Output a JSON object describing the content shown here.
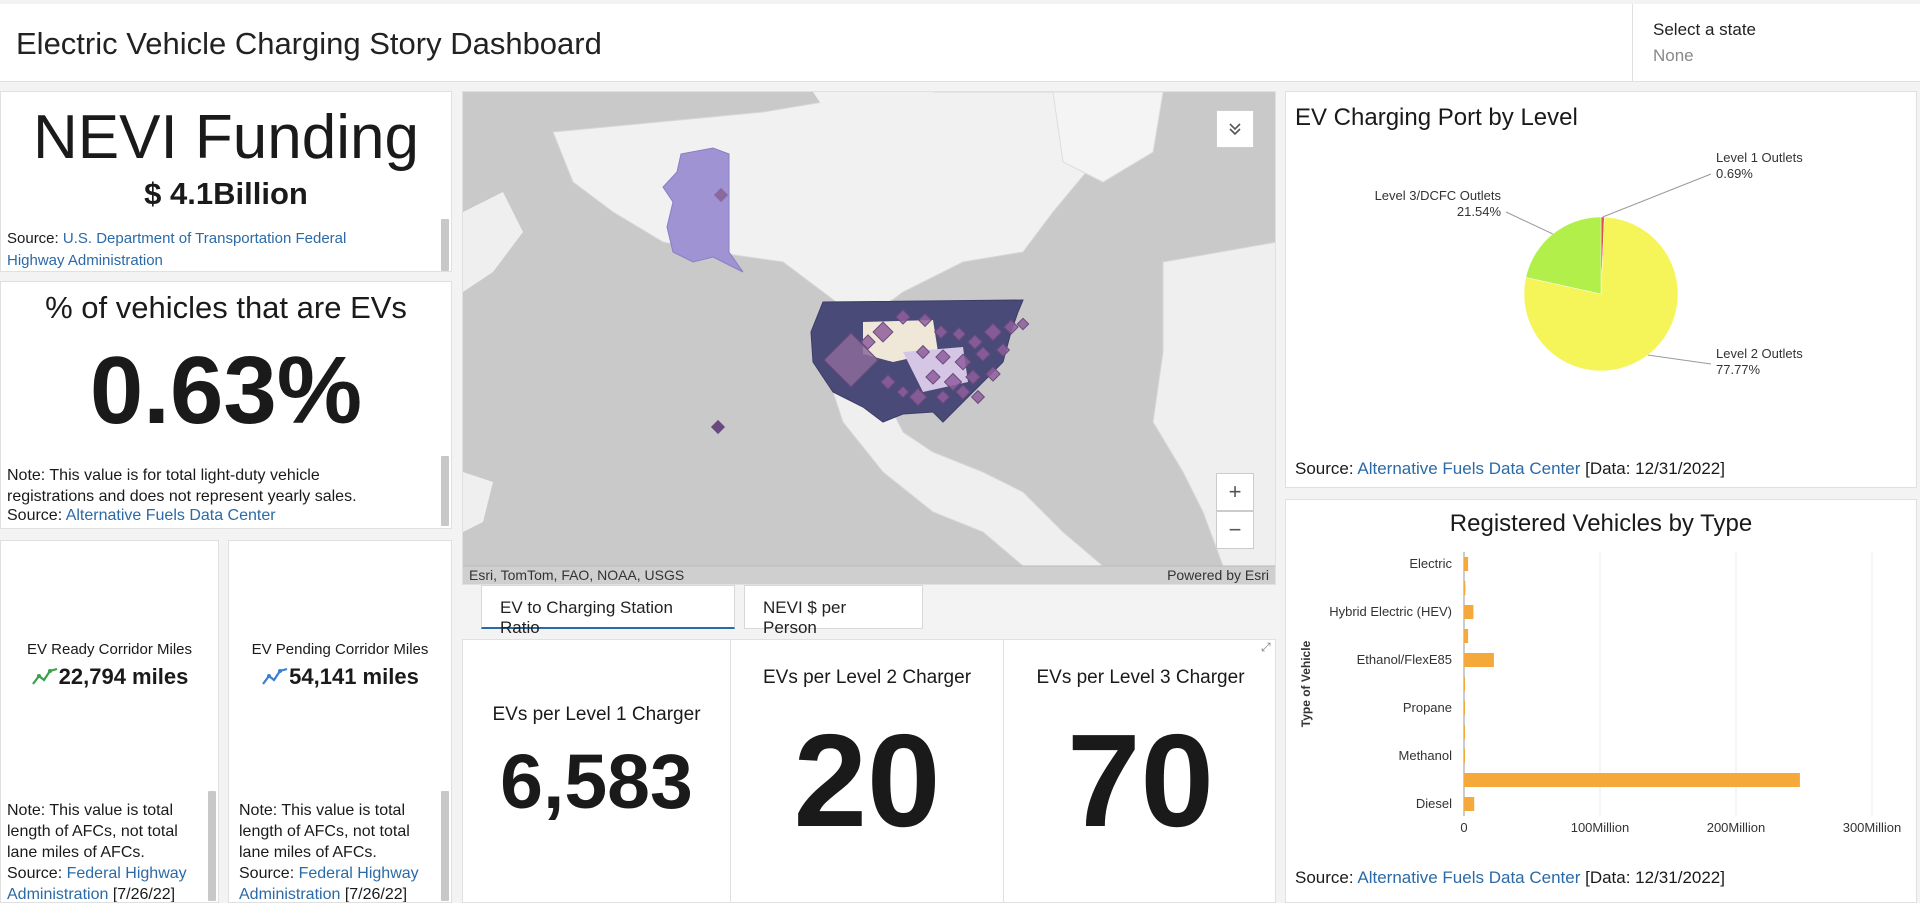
{
  "header": {
    "title": "Electric Vehicle Charging Story Dashboard",
    "state_label": "Select a state",
    "state_value": "None"
  },
  "nevi": {
    "title": "NEVI Funding",
    "value": "$ 4.1Billion",
    "source_prefix": "Source: ",
    "source_link": "U.S. Department of Transportation Federal Highway Administration"
  },
  "ev_pct": {
    "title": "% of vehicles that are EVs",
    "value": "0.63%",
    "note": "Note: This value is for total light-duty vehicle registrations and does not represent yearly sales.",
    "source_prefix": "Source: ",
    "source_link": "Alternative Fuels Data Center"
  },
  "corridor_ready": {
    "title": "EV Ready Corridor Miles",
    "value": "22,794 miles",
    "note": "Note: This value is total length of AFCs, not total lane miles of AFCs.",
    "source_prefix": "Source: ",
    "source_link": "Federal Highway Administration",
    "date": " [7/26/22]",
    "icon_color": "#3aa14a"
  },
  "corridor_pending": {
    "title": "EV Pending Corridor Miles",
    "value": "54,141 miles",
    "note": "Note: This value is total length of AFCs, not total lane miles of AFCs.",
    "source_prefix": "Source: ",
    "source_link": "Federal Highway Administration",
    "date": " [7/26/22]",
    "icon_color": "#3a7fd0"
  },
  "map": {
    "attribution": "Esri, TomTom, FAO, NOAA, USGS",
    "powered": "Powered by Esri",
    "zoom_in": "+",
    "zoom_out": "−",
    "collapse_icon": "chevron-double-down-icon"
  },
  "tabs": [
    {
      "label": "EV to Charging Station Ratio",
      "active": true
    },
    {
      "label": "NEVI $ per Person",
      "active": false
    }
  ],
  "kpis": [
    {
      "label": "EVs per Level 1 Charger",
      "value": "6,583"
    },
    {
      "label": "EVs per Level 2 Charger",
      "value": "20"
    },
    {
      "label": "EVs per Level 3 Charger",
      "value": "70"
    }
  ],
  "pie_panel": {
    "source_prefix": "Source: ",
    "source_link": "Alternative Fuels Data Center",
    "date": " [Data: 12/31/2022]"
  },
  "bar_panel": {
    "source_prefix": "Source: ",
    "source_link": "Alternative Fuels Data Center",
    "date": " [Data: 12/31/2022]"
  },
  "chart_data": [
    {
      "type": "pie",
      "title": "EV Charging Port by Level",
      "slices": [
        {
          "name": "Level 1 Outlets",
          "value": 0.69,
          "label": "0.69%",
          "color": "#e05050"
        },
        {
          "name": "Level 2 Outlets",
          "value": 77.77,
          "label": "77.77%",
          "color": "#f5f55a"
        },
        {
          "name": "Level 3/DCFC Outlets",
          "value": 21.54,
          "label": "21.54%",
          "color": "#b3ef4a"
        }
      ]
    },
    {
      "type": "bar",
      "orientation": "horizontal",
      "title": "Registered Vehicles by Type",
      "ylabel": "Type of Vehicle",
      "xlabel": "",
      "categories": [
        "Electric",
        "",
        "Hybrid Electric (HEV)",
        "",
        "Ethanol/FlexE85",
        "",
        "Propane",
        "",
        "Methanol",
        "",
        "Diesel"
      ],
      "values": [
        3000000,
        1000000,
        6900000,
        3000000,
        22000000,
        300000,
        100000,
        200000,
        100000,
        247000000,
        7500000
      ],
      "xlim": [
        0,
        300000000
      ],
      "xticks": [
        0,
        100000000,
        200000000,
        300000000
      ],
      "xtick_labels": [
        "0",
        "100Million",
        "200Million",
        "300Million"
      ],
      "color": "#f4a93a"
    }
  ]
}
